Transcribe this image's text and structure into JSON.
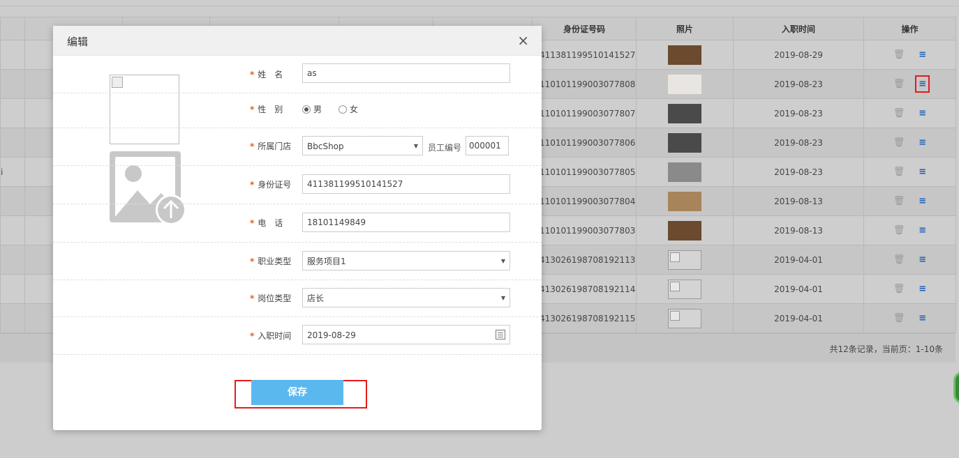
{
  "table": {
    "headers": {
      "id_card": "身份证号码",
      "photo": "照片",
      "hire_date": "入职时间",
      "actions": "操作"
    },
    "partial_text": "i",
    "rows": [
      {
        "id_card": "411381199510141527",
        "photo": "dog",
        "hire_date": "2019-08-29"
      },
      {
        "id_card": "110101199003077808",
        "photo": "anime-character",
        "hire_date": "2019-08-23"
      },
      {
        "id_card": "110101199003077807",
        "photo": "person",
        "hire_date": "2019-08-23"
      },
      {
        "id_card": "110101199003077806",
        "photo": "person",
        "hire_date": "2019-08-23"
      },
      {
        "id_card": "110101199003077805",
        "photo": "cat",
        "hire_date": "2019-08-23"
      },
      {
        "id_card": "110101199003077804",
        "photo": "animal",
        "hire_date": "2019-08-13"
      },
      {
        "id_card": "110101199003077803",
        "photo": "dog",
        "hire_date": "2019-08-13"
      },
      {
        "id_card": "413026198708192113",
        "photo": "broken-image",
        "hire_date": "2019-04-01"
      },
      {
        "id_card": "413026198708192114",
        "photo": "broken-image",
        "hire_date": "2019-04-01"
      },
      {
        "id_card": "413026198708192115",
        "photo": "broken-image",
        "hire_date": "2019-04-01"
      }
    ],
    "delete_icon": "trash-icon",
    "edit_icon": "edit-icon",
    "pagination_text": "共12条记录，当前页：1-10条"
  },
  "dialog": {
    "title": "编辑",
    "close_glyph": "×",
    "fields": {
      "name_label": "姓　名",
      "name_value": "as",
      "gender_label": "性　别",
      "gender_male": "男",
      "gender_female": "女",
      "gender_selected": "男",
      "store_label": "所属门店",
      "store_value": "BbcShop",
      "staff_no_label": "员工编号",
      "staff_no_value": "000001",
      "id_label": "身份证号",
      "id_value": "411381199510141527",
      "phone_label": "电　话",
      "phone_value": "18101149849",
      "job_type_label": "职业类型",
      "job_type_value": "服务项目1",
      "position_label": "岗位类型",
      "position_value": "店长",
      "hire_label": "入职时间",
      "hire_value": "2019-08-29"
    },
    "required_mark": "*",
    "save_label": "保存"
  },
  "colors": {
    "accent": "#5bb8ef",
    "required": "#e85a1a",
    "highlight": "#e31b1b",
    "edit_icon": "#1e5fb8"
  }
}
